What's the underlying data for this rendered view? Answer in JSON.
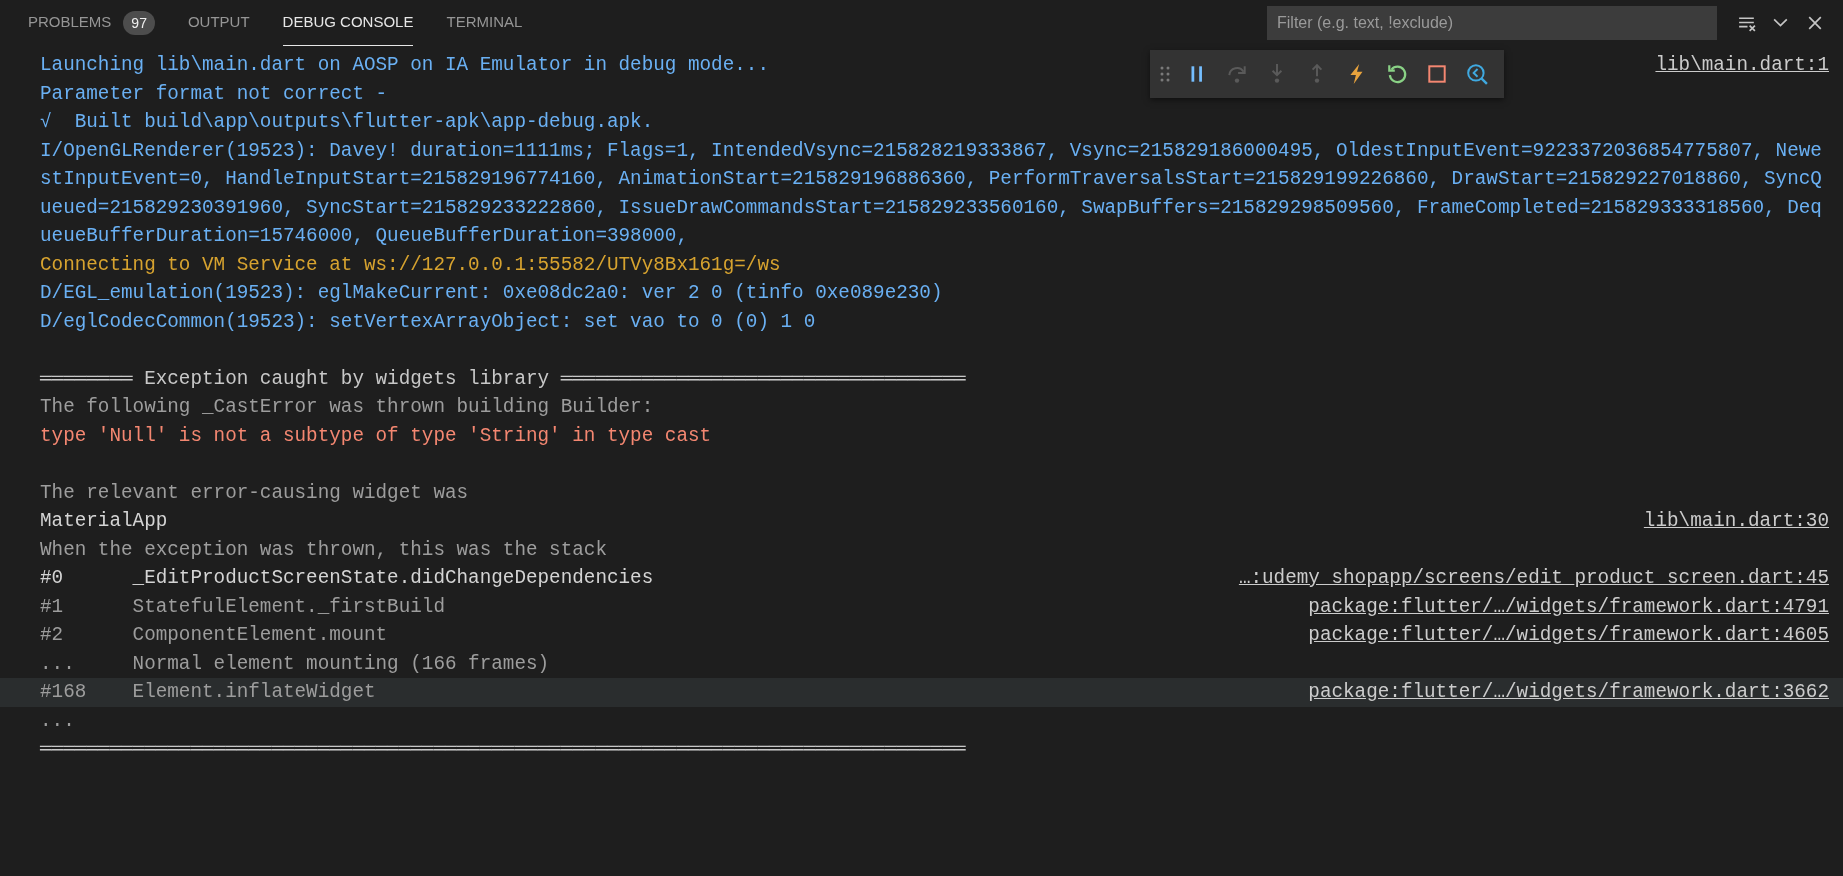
{
  "panel_tabs": [
    {
      "label": "PROBLEMS",
      "badge": "97",
      "selected": false
    },
    {
      "label": "OUTPUT",
      "selected": false
    },
    {
      "label": "DEBUG CONSOLE",
      "selected": true
    },
    {
      "label": "TERMINAL",
      "selected": false
    }
  ],
  "filter": {
    "placeholder": "Filter (e.g. text, !exclude)"
  },
  "panel_actions": [
    {
      "kind": "clear"
    },
    {
      "kind": "collapse"
    },
    {
      "kind": "close"
    }
  ],
  "debug_toolbar": {
    "buttons": [
      {
        "kind": "pause",
        "disabled": false
      },
      {
        "kind": "step-over",
        "disabled": true
      },
      {
        "kind": "step-into",
        "disabled": true
      },
      {
        "kind": "step-out",
        "disabled": true
      },
      {
        "kind": "hot-reload",
        "disabled": false
      },
      {
        "kind": "restart",
        "disabled": false
      },
      {
        "kind": "stop",
        "disabled": false
      },
      {
        "kind": "devtools",
        "disabled": false
      }
    ]
  },
  "console_lines": [
    {
      "kind": "info",
      "text": "Launching lib\\main.dart on AOSP on IA Emulator in debug mode...",
      "link": "lib\\main.dart:1"
    },
    {
      "kind": "info",
      "text": "Parameter format not correct -"
    },
    {
      "kind": "info",
      "text": "√  Built build\\app\\outputs\\flutter-apk\\app-debug.apk."
    },
    {
      "kind": "info",
      "text": "I/OpenGLRenderer(19523): Davey! duration=1111ms; Flags=1, IntendedVsync=215828219333867, Vsync=215829186000495, OldestInputEvent=9223372036854775807, NewestInputEvent=0, HandleInputStart=215829196774160, AnimationStart=215829196886360, PerformTraversalsStart=215829199226860, DrawStart=215829227018860, SyncQueued=215829230391960, SyncStart=215829233222860, IssueDrawCommandsStart=215829233560160, SwapBuffers=215829298509560, FrameCompleted=215829333318560, DequeueBufferDuration=15746000, QueueBufferDuration=398000,"
    },
    {
      "kind": "warning",
      "text": "Connecting to VM Service at ws://127.0.0.1:55582/UTVy8Bx161g=/ws"
    },
    {
      "kind": "info",
      "text": "D/EGL_emulation(19523): eglMakeCurrent: 0xe08dc2a0: ver 2 0 (tinfo 0xe089e230)"
    },
    {
      "kind": "info",
      "text": "D/eglCodecCommon(19523): setVertexArrayObject: set vao to 0 (0) 1 0"
    },
    {
      "kind": "blank"
    },
    {
      "kind": "separator",
      "text": "════════ Exception caught by widgets library ═══════════════════════════════════"
    },
    {
      "kind": "plain",
      "text": "The following _CastError was thrown building Builder:"
    },
    {
      "kind": "error",
      "text": "type 'Null' is not a subtype of type 'String' in type cast"
    },
    {
      "kind": "blank"
    },
    {
      "kind": "plain",
      "text": "The relevant error-causing widget was"
    },
    {
      "kind": "bright",
      "text": "MaterialApp",
      "link": "lib\\main.dart:30"
    },
    {
      "kind": "plain",
      "text": "When the exception was thrown, this was the stack"
    },
    {
      "kind": "frame",
      "index": "#0",
      "text": "_EditProductScreenState.didChangeDependencies",
      "link": "…:udemy_shopapp/screens/edit_product_screen.dart:45",
      "dimmed": false,
      "selected": false
    },
    {
      "kind": "frame",
      "index": "#1",
      "text": "StatefulElement._firstBuild",
      "link": "package:flutter/…/widgets/framework.dart:4791",
      "dimmed": true,
      "selected": false
    },
    {
      "kind": "frame",
      "index": "#2",
      "text": "ComponentElement.mount",
      "link": "package:flutter/…/widgets/framework.dart:4605",
      "dimmed": true,
      "selected": false
    },
    {
      "kind": "frame",
      "index": "...",
      "text": "Normal element mounting (166 frames)",
      "dimmed": true,
      "selected": false
    },
    {
      "kind": "frame",
      "index": "#168",
      "text": "Element.inflateWidget",
      "link": "package:flutter/…/widgets/framework.dart:3662",
      "dimmed": true,
      "selected": true
    },
    {
      "kind": "plain",
      "text": "..."
    },
    {
      "kind": "separator",
      "text": "════════════════════════════════════════════════════════════════════════════════"
    }
  ]
}
